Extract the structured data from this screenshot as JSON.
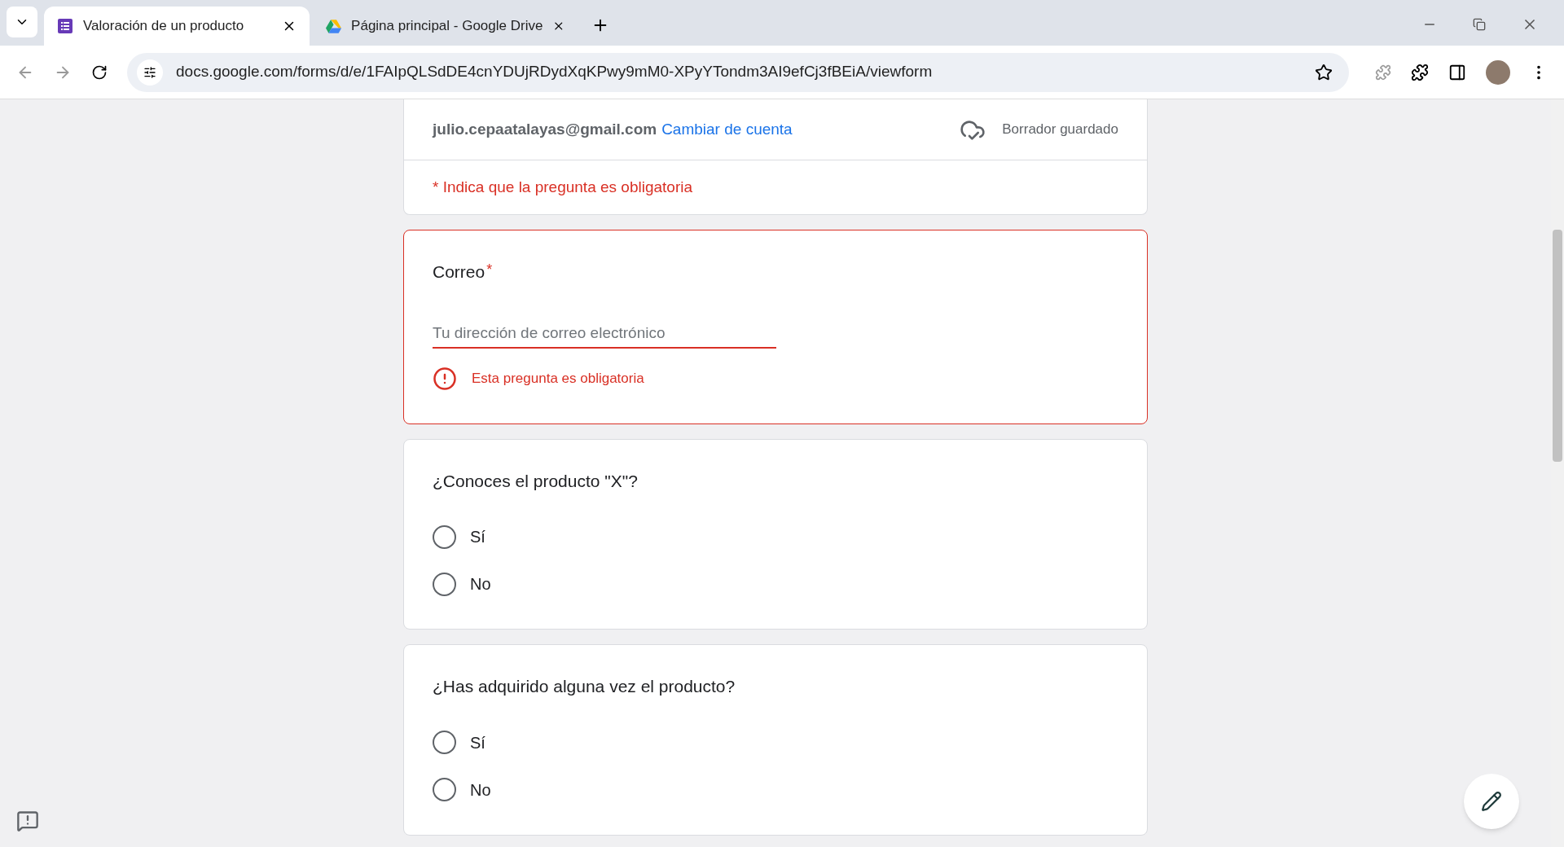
{
  "browser": {
    "tabs": [
      {
        "title": "Valoración de un producto",
        "kind": "forms",
        "selected": true
      },
      {
        "title": "Página principal - Google Drive",
        "kind": "drive",
        "selected": false
      }
    ],
    "url": "docs.google.com/forms/d/e/1FAIpQLSdDE4cnYDUjRDydXqKPwy9mM0-XPyYTondm3AI9efCj3fBEiA/viewform"
  },
  "form": {
    "account": "julio.cepaatalayas@gmail.com",
    "switch_account": "Cambiar de cuenta",
    "draft_status": "Borrador guardado",
    "required_note": "* Indica que la pregunta es obligatoria",
    "questions": [
      {
        "kind": "text",
        "title": "Correo",
        "required_mark": "*",
        "placeholder": "Tu dirección de correo electrónico",
        "error": "Esta pregunta es obligatoria"
      },
      {
        "kind": "radio",
        "title": "¿Conoces el producto \"X\"?",
        "options": [
          {
            "label": "Sí",
            "selected": false
          },
          {
            "label": "No",
            "selected": false
          }
        ]
      },
      {
        "kind": "radio",
        "title": "¿Has adquirido alguna vez el producto?",
        "options": [
          {
            "label": "Sí",
            "selected": false
          },
          {
            "label": "No",
            "selected": false
          }
        ]
      }
    ]
  }
}
